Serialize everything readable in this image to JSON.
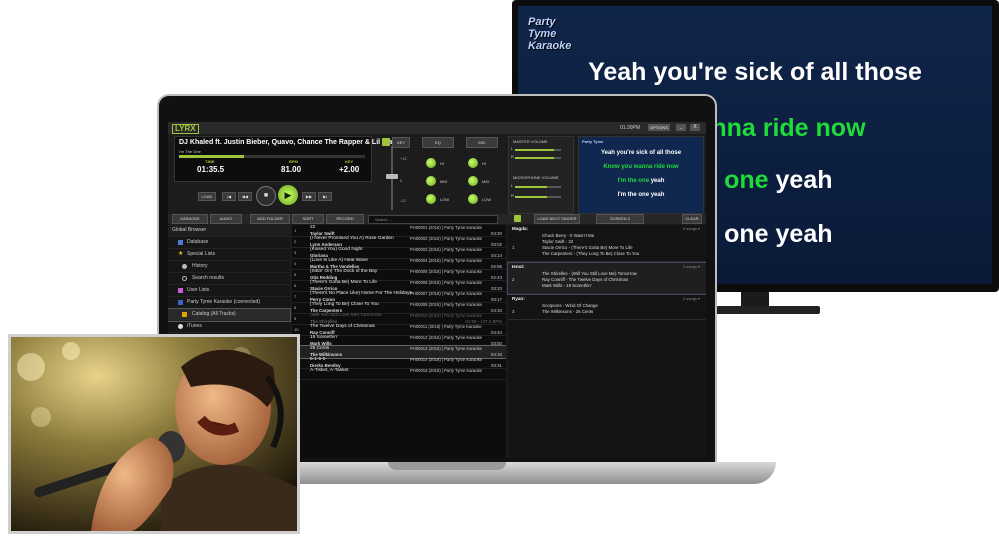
{
  "tv": {
    "logo": "Party Tyme Karaoke",
    "lines": [
      {
        "white": "Yeah you're sick of all those",
        "green": ""
      },
      {
        "white": "",
        "green": "wanna ride now"
      },
      {
        "white": " yeah",
        "green": "ne one"
      },
      {
        "white": "ne one yeah",
        "green": ""
      }
    ]
  },
  "app": {
    "logo": "LYRX",
    "clock": "01:30PM",
    "options": "OPTIONS",
    "minimize": "_",
    "close": "X",
    "now_playing": {
      "title": "DJ Khaled ft. Justin Bieber, Quavo, Chance The Rapper & Lil Wayne",
      "song": "I'm The One",
      "progress_fraction": 0.35,
      "labels": {
        "time": "TIME",
        "bpm": "BPM",
        "key": "KEY"
      },
      "values": {
        "time": "01:35.5",
        "bpm": "81.00",
        "key": "+2.00"
      }
    },
    "transport": {
      "load": "LOAD",
      "prev": "|◀",
      "rew": "◀◀",
      "stop": "■",
      "play": "▶",
      "fwd": "▶▶",
      "next": "▶|"
    },
    "fader": {
      "plus": "+12",
      "zero": "0",
      "minus": "-12"
    },
    "mixer": {
      "key": "KEY",
      "eq": "EQ",
      "mic": "MIC",
      "left": [
        "HI",
        "MID",
        "LOW"
      ],
      "right": [
        "HI",
        "MID",
        "LOW"
      ]
    },
    "volume": {
      "master": "MASTER VOLUME",
      "microphone": "MICROPHONE VOLUME",
      "l": "L",
      "r": "R",
      "master_level": 0.85,
      "mic_level": 0.7
    },
    "preview": {
      "logo": "Party Tyme",
      "lines": [
        {
          "text": "Yeah you're sick of all those",
          "green": false
        },
        {
          "text": "Know you wanna ride now",
          "green": true
        },
        {
          "text": "I'm the one yeah",
          "green": false,
          "partial_green": "I'm the one"
        },
        {
          "text": "I'm the one yeah",
          "green": false
        }
      ]
    },
    "toolbar": {
      "karaoke": "KARAOKE",
      "audio": "AUDIO",
      "add_folder": "ADD FOLDER",
      "sort": "SORT",
      "record": "RECORD",
      "search_placeholder": "Search ...",
      "load_next_singer": "LOAD NEXT SINGER",
      "screen2": "SCREEN 2",
      "clear": "CLEAR"
    },
    "sidebar": [
      {
        "label": "Global Browser",
        "icon": "globe-icon"
      },
      {
        "label": "Database",
        "icon": "database-icon"
      },
      {
        "label": "Special Lists",
        "icon": "star-icon"
      },
      {
        "label": "History",
        "icon": "clock-icon"
      },
      {
        "label": "Search results",
        "icon": "search-icon"
      },
      {
        "label": "User Lists",
        "icon": "list-icon"
      },
      {
        "label": "Party Tyme Karaoke (connected)",
        "icon": "party-tyme-icon"
      },
      {
        "label": "Catalog (All Tracks)",
        "icon": "catalog-icon"
      },
      {
        "label": "iTunes",
        "icon": "itunes-icon"
      }
    ],
    "tracks": [
      {
        "n": "1",
        "title": "22",
        "artist": "Taylor Swift",
        "code": "PH00001 (2016) | Party Tyme Karaoke",
        "dur": "04:20"
      },
      {
        "n": "2",
        "title": "(I Never Promised You A) Rose Garden",
        "artist": "Lynn Anderson",
        "code": "PH00002 (2016) | Party Tyme Karaoke",
        "dur": "03:02"
      },
      {
        "n": "3",
        "title": "(Kissed You) Good Night",
        "artist": "Gloriana",
        "code": "PH00003 (2016) | Party Tyme Karaoke",
        "dur": "04:14"
      },
      {
        "n": "4",
        "title": "(Love Is Like A) Heat Wave",
        "artist": "Martha & The Vandellas",
        "code": "PH00004 (2016) | Party Tyme Karaoke",
        "dur": "02:56"
      },
      {
        "n": "5",
        "title": "(Sittin' On) The Dock of the Bay",
        "artist": "Otis Redding",
        "code": "PH00005 (2016) | Party Tyme Karaoke",
        "dur": "02:43"
      },
      {
        "n": "6",
        "title": "(There's Gotta Be) More To Life",
        "artist": "Stacie Orrico",
        "code": "PH00006 (2016) | Party Tyme Karaoke",
        "dur": "03:23"
      },
      {
        "n": "7",
        "title": "(There's No Place Like) Home For The Holidays",
        "artist": "Perry Como",
        "code": "PH00007 (2016) | Party Tyme Karaoke",
        "dur": "03:17"
      },
      {
        "n": "8",
        "title": "(They Long To Be) Close To You",
        "artist": "The Carpenters",
        "code": "PH00008 (2016) | Party Tyme Karaoke",
        "dur": "04:10"
      },
      {
        "n": "9",
        "title": "(Will You Still Love Me) Tomorrow",
        "artist": "The Shirelles",
        "code": "PH00010 (2016) | Party Tyme Karaoke",
        "dur": "02:58 - 137.0 BPM",
        "dim": true
      },
      {
        "n": "10",
        "title": "The Twelve Days of Christmas",
        "artist": "Ray Conniff",
        "code": "PH00011 (2016) | Party Tyme Karaoke",
        "dur": "04:44"
      },
      {
        "n": "11",
        "title": "19 Somethin'",
        "artist": "Mark Wills",
        "code": "PH00012 (2016) | Party Tyme Karaoke",
        "dur": "03:50"
      },
      {
        "n": "12",
        "title": "26 Cents",
        "artist": "The Wilkinsons",
        "code": "PH00013 (2016) | Party Tyme Karaoke",
        "dur": "04:16",
        "selected": true
      },
      {
        "n": "13",
        "title": "5-1-5-0",
        "artist": "Dierks Bentley",
        "code": "PH00014 (2016) | Party Tyme Karaoke",
        "dur": "03:31"
      },
      {
        "n": "14",
        "title": "A-Tisket, A-Tasket",
        "artist": "",
        "code": "PH00016 (2016) | Party Tyme Karaoke",
        "dur": ""
      }
    ],
    "queue": [
      {
        "singer": "Magda:",
        "num": "1",
        "count": "4 songs ▾",
        "songs": [
          "Chuck Berry - It Wasn't Me",
          "Taylor Swift - 22",
          "Stacie Orrico - (There's Gotta Be) More To Life",
          "The Carpenters - (They Long To Be) Close To You"
        ]
      },
      {
        "singer": "Ienut:",
        "num": "2",
        "count": "3 songs ▾",
        "songs": [
          "The Shirelles - (Will You Still Love Me) Tomorrow",
          "Ray Conniff - The Twelve Days of Christmas",
          "Mark Wills - 19 Somethin'"
        ]
      },
      {
        "singer": "Ryan:",
        "num": "3",
        "count": "2 songs ▾",
        "songs": [
          "Scorpions - Wind Of Change",
          "The Wilkinsons - 26 Cents"
        ]
      }
    ]
  },
  "colors": {
    "accent": "#9ec63b",
    "lyric_green": "#1edb3a",
    "tv_blue": "#10254a"
  }
}
